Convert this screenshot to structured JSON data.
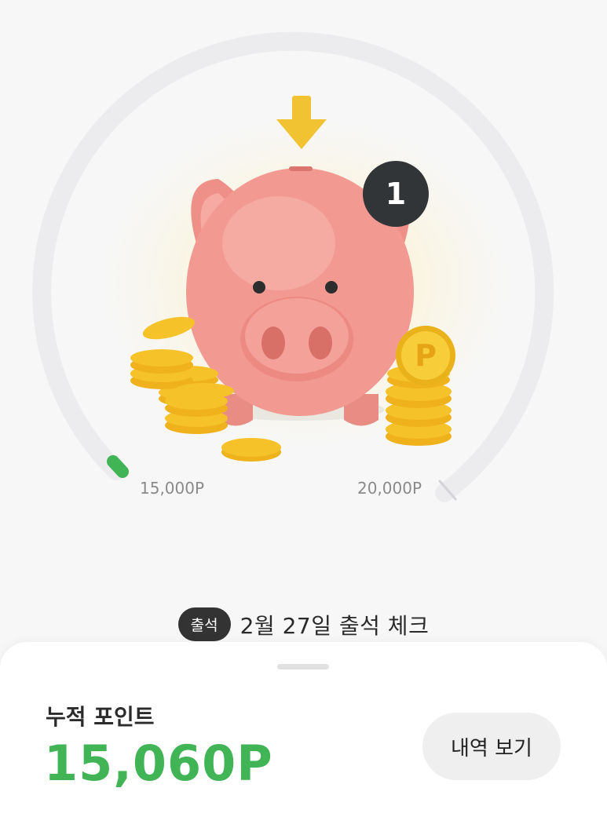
{
  "colors": {
    "accent_green": "#41b455",
    "pig_pink": "#f29a92",
    "coin_gold": "#f6c22a",
    "arrow_gold": "#f1c232",
    "badge_dark": "#323538"
  },
  "icons": {
    "arrow": "arrow-down-icon",
    "pig": "piggy-bank-icon",
    "coin": "coin-icon"
  },
  "progress": {
    "min_label": "15,000P",
    "max_label": "20,000P",
    "fraction": 0.012
  },
  "badge": {
    "count": "1"
  },
  "attendance": {
    "chip_label": "출석",
    "text": "2월 27일 출석 체크"
  },
  "points": {
    "label": "누적 포인트",
    "value": "15,060P",
    "history_button": "내역 보기"
  }
}
